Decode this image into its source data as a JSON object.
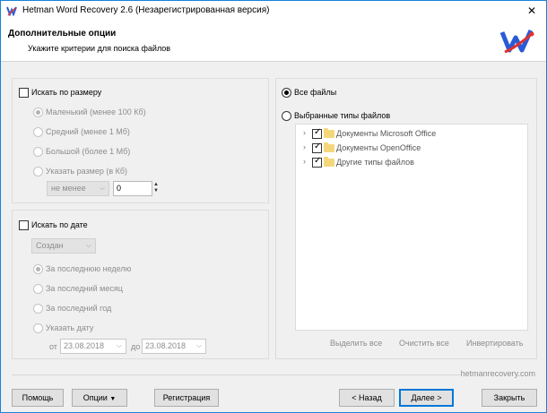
{
  "window": {
    "title": "Hetman Word Recovery 2.6 (Незарегистрированная версия)",
    "close_glyph": "✕"
  },
  "header": {
    "title": "Дополнительные опции",
    "subtitle": "Укажите критерии для поиска файлов"
  },
  "size_filter": {
    "label": "Искать по размеру",
    "checked": false,
    "options": [
      {
        "label": "Маленький (менее 100 Кб)",
        "selected": true
      },
      {
        "label": "Средний (менее 1 Мб)",
        "selected": false
      },
      {
        "label": "Большой (более 1 Мб)",
        "selected": false
      },
      {
        "label": "Указать размер (в Кб)",
        "selected": false
      }
    ],
    "comparator": "не менее",
    "value": "0"
  },
  "date_filter": {
    "label": "Искать по дате",
    "checked": false,
    "date_type": "Создан",
    "options": [
      {
        "label": "За последнюю неделю",
        "selected": true
      },
      {
        "label": "За последний месяц",
        "selected": false
      },
      {
        "label": "За последний год",
        "selected": false
      },
      {
        "label": "Указать дату",
        "selected": false
      }
    ],
    "from_label": "от",
    "from_value": "23.08.2018",
    "to_label": "до",
    "to_value": "23.08.2018"
  },
  "file_types": {
    "all_files_label": "Все файлы",
    "selected_types_label": "Выбранные типы файлов",
    "tree": [
      {
        "label": "Документы Microsoft Office",
        "checked": true
      },
      {
        "label": "Документы OpenOffice",
        "checked": true
      },
      {
        "label": "Другие типы файлов",
        "checked": true
      }
    ],
    "select_all": "Выделить все",
    "clear_all": "Очистить все",
    "invert": "Инвертировать"
  },
  "footer": {
    "site": "hetmanrecovery.com",
    "help": "Помощь",
    "options": "Опции",
    "options_arrow": "▼",
    "register": "Регистрация",
    "back": "< Назад",
    "next": "Далее >",
    "close": "Закрыть"
  }
}
